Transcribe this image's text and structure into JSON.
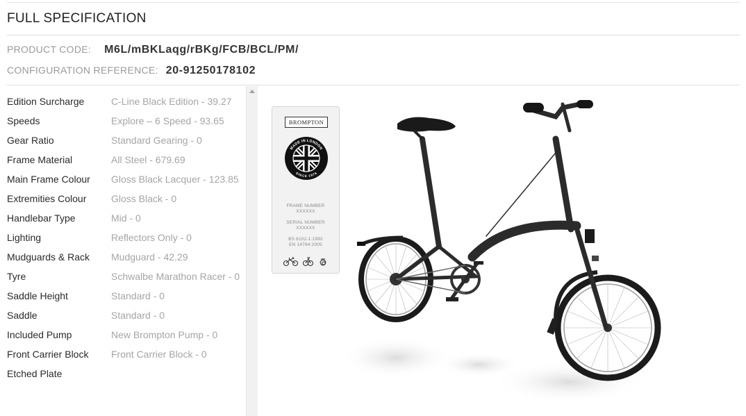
{
  "header": {
    "title": "FULL SPECIFICATION"
  },
  "product": {
    "code_label": "PRODUCT CODE:",
    "code_value": "M6L/mBKLaqg/rBKg/FCB/BCL/PM/",
    "config_label": "CONFIGURATION REFERENCE:",
    "config_value": "20-91250178102"
  },
  "specs": [
    {
      "name": "Edition Surcharge",
      "value": "C-Line Black Edition - 39.27"
    },
    {
      "name": "Speeds",
      "value": "Explore – 6 Speed - 93.65"
    },
    {
      "name": "Gear Ratio",
      "value": "Standard Gearing - 0"
    },
    {
      "name": "Frame Material",
      "value": "All Steel - 679.69"
    },
    {
      "name": "Main Frame Colour",
      "value": "Gloss Black Lacquer - 123.85"
    },
    {
      "name": "Extremities Colour",
      "value": "Gloss Black - 0"
    },
    {
      "name": "Handlebar Type",
      "value": "Mid - 0"
    },
    {
      "name": "Lighting",
      "value": "Reflectors Only - 0"
    },
    {
      "name": "Mudguards & Rack",
      "value": "Mudguard - 42.29"
    },
    {
      "name": "Tyre",
      "value": "Schwalbe Marathon Racer - 0"
    },
    {
      "name": "Saddle Height",
      "value": "Standard - 0"
    },
    {
      "name": "Saddle",
      "value": "Standard - 0"
    },
    {
      "name": "Included Pump",
      "value": "New Brompton Pump - 0"
    },
    {
      "name": "Front Carrier Block",
      "value": "Front Carrier Block - 0"
    },
    {
      "name": "Etched Plate",
      "value": ""
    }
  ],
  "plate": {
    "brand": "BROMPTON",
    "badge_top": "MADE IN LONDON",
    "badge_bottom": "SINCE 1976",
    "frame_number_label": "FRAME NUMBER",
    "frame_number_value": "XXXXXX",
    "serial_number_label": "SERIAL NUMBER",
    "serial_number_value": "XXXXXX",
    "standard_1": "BS 6102-1:1992",
    "standard_2": "EN 14764:2005"
  },
  "colors": {
    "frame": "#2b2b2b",
    "accent_text": "#a5a5a5"
  }
}
